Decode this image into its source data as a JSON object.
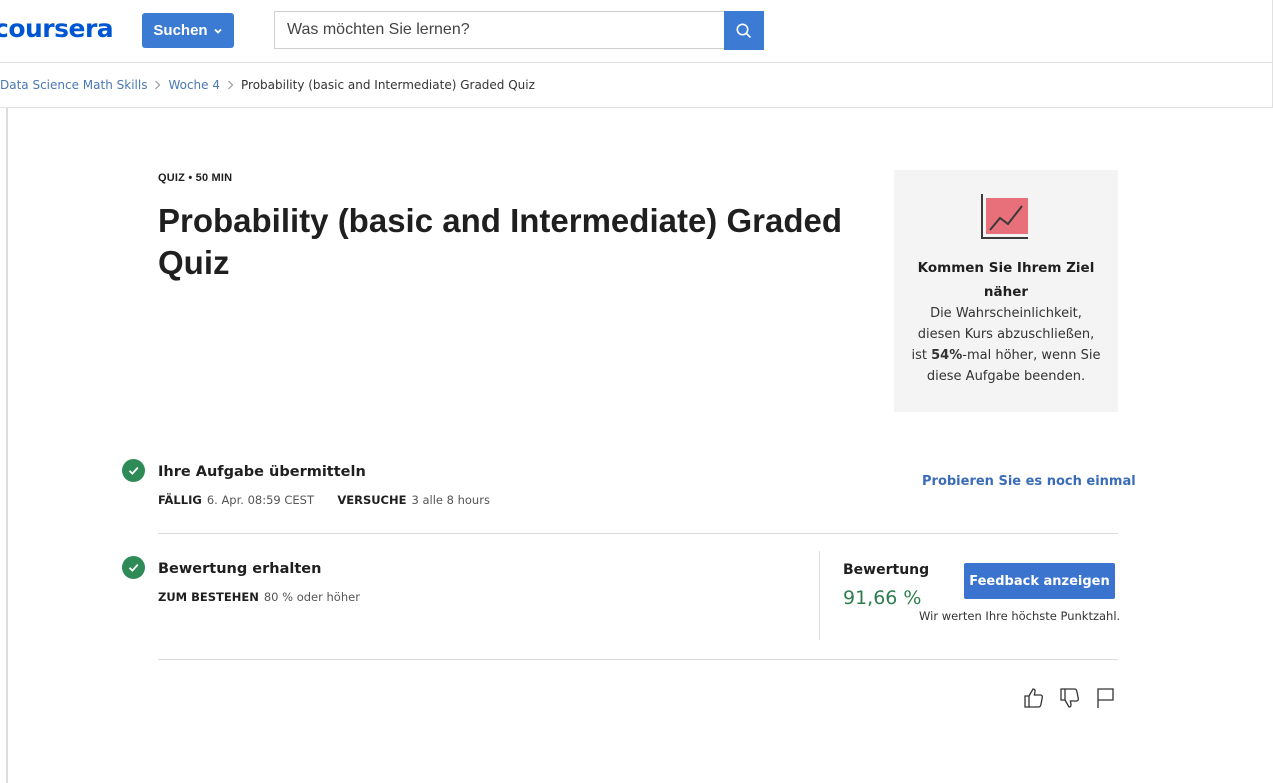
{
  "header": {
    "logo": "coursera",
    "search_button_label": "Suchen",
    "search_placeholder": "Was möchten Sie lernen?"
  },
  "breadcrumb": {
    "course": "Data Science Math Skills",
    "week": "Woche 4",
    "current": "Probability (basic and Intermediate) Graded Quiz"
  },
  "quiz": {
    "meta": "QUIZ • 50 MIN",
    "title": "Probability (basic and Intermediate) Graded Quiz"
  },
  "goal_card": {
    "heading": "Kommen Sie Ihrem Ziel näher",
    "text_before": "Die Wahrscheinlichkeit, diesen Kurs abzuschließen, ist ",
    "percent": "54%",
    "text_after": "-mal höher, wenn Sie diese Aufgabe beenden.",
    "icon_color": "#e8707a"
  },
  "submit_row": {
    "title": "Ihre Aufgabe übermitteln",
    "due_label": "FÄLLIG",
    "due_value": "6. Apr. 08:59 CEST",
    "attempts_label": "VERSUCHE",
    "attempts_value": "3 alle 8 hours",
    "retry_label": "Probieren Sie es noch einmal"
  },
  "grade_row": {
    "title": "Bewertung erhalten",
    "pass_label": "ZUM BESTEHEN",
    "pass_value": "80 % oder höher",
    "grade_label": "Bewertung",
    "grade_value": "91,66 %",
    "feedback_button": "Feedback anzeigen",
    "note": "Wir werten Ihre höchste Punktzahl."
  },
  "colors": {
    "brand": "#0056d2",
    "button": "#3b7bd4",
    "success": "#2e8b57",
    "link": "#3b6cb8"
  }
}
